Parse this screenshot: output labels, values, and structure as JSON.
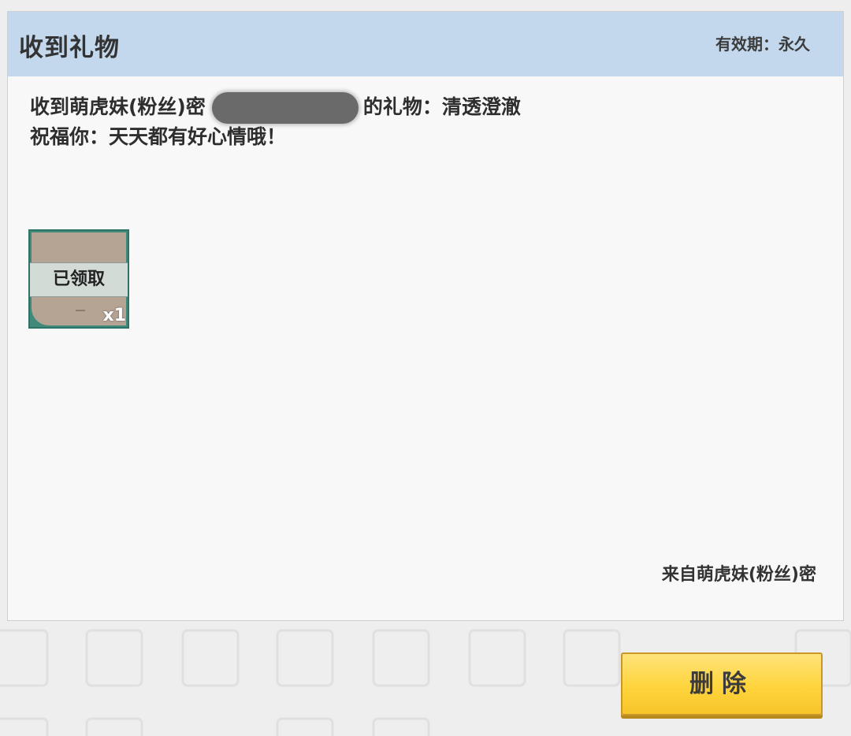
{
  "dialog": {
    "title": "收到礼物",
    "validity": "有效期：永久",
    "message_prefix": "收到萌虎妹(粉丝)密",
    "message_suffix": "的礼物：清透澄澈",
    "blessing": "祝福你：天天都有好心情哦！",
    "gift": {
      "status_label": "已领取",
      "quantity": "x1",
      "icon": "gift-item-icon"
    },
    "from": "来自萌虎妹(粉丝)密"
  },
  "actions": {
    "delete_label": "删除"
  },
  "colors": {
    "header_bg": "#c3d8ec",
    "card_bg": "#f8f8f8",
    "button_yellow": "#ffd43c",
    "page_bg": "#eeeeee"
  }
}
